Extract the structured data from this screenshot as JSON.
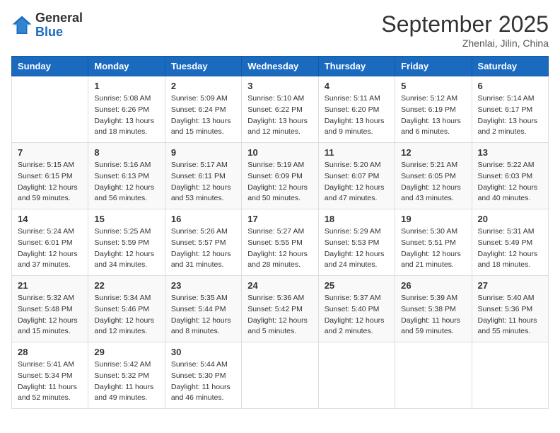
{
  "header": {
    "logo_general": "General",
    "logo_blue": "Blue",
    "title": "September 2025",
    "subtitle": "Zhenlai, Jilin, China"
  },
  "days_of_week": [
    "Sunday",
    "Monday",
    "Tuesday",
    "Wednesday",
    "Thursday",
    "Friday",
    "Saturday"
  ],
  "weeks": [
    [
      {
        "day": "",
        "info": ""
      },
      {
        "day": "1",
        "info": "Sunrise: 5:08 AM\nSunset: 6:26 PM\nDaylight: 13 hours\nand 18 minutes."
      },
      {
        "day": "2",
        "info": "Sunrise: 5:09 AM\nSunset: 6:24 PM\nDaylight: 13 hours\nand 15 minutes."
      },
      {
        "day": "3",
        "info": "Sunrise: 5:10 AM\nSunset: 6:22 PM\nDaylight: 13 hours\nand 12 minutes."
      },
      {
        "day": "4",
        "info": "Sunrise: 5:11 AM\nSunset: 6:20 PM\nDaylight: 13 hours\nand 9 minutes."
      },
      {
        "day": "5",
        "info": "Sunrise: 5:12 AM\nSunset: 6:19 PM\nDaylight: 13 hours\nand 6 minutes."
      },
      {
        "day": "6",
        "info": "Sunrise: 5:14 AM\nSunset: 6:17 PM\nDaylight: 13 hours\nand 2 minutes."
      }
    ],
    [
      {
        "day": "7",
        "info": "Sunrise: 5:15 AM\nSunset: 6:15 PM\nDaylight: 12 hours\nand 59 minutes."
      },
      {
        "day": "8",
        "info": "Sunrise: 5:16 AM\nSunset: 6:13 PM\nDaylight: 12 hours\nand 56 minutes."
      },
      {
        "day": "9",
        "info": "Sunrise: 5:17 AM\nSunset: 6:11 PM\nDaylight: 12 hours\nand 53 minutes."
      },
      {
        "day": "10",
        "info": "Sunrise: 5:19 AM\nSunset: 6:09 PM\nDaylight: 12 hours\nand 50 minutes."
      },
      {
        "day": "11",
        "info": "Sunrise: 5:20 AM\nSunset: 6:07 PM\nDaylight: 12 hours\nand 47 minutes."
      },
      {
        "day": "12",
        "info": "Sunrise: 5:21 AM\nSunset: 6:05 PM\nDaylight: 12 hours\nand 43 minutes."
      },
      {
        "day": "13",
        "info": "Sunrise: 5:22 AM\nSunset: 6:03 PM\nDaylight: 12 hours\nand 40 minutes."
      }
    ],
    [
      {
        "day": "14",
        "info": "Sunrise: 5:24 AM\nSunset: 6:01 PM\nDaylight: 12 hours\nand 37 minutes."
      },
      {
        "day": "15",
        "info": "Sunrise: 5:25 AM\nSunset: 5:59 PM\nDaylight: 12 hours\nand 34 minutes."
      },
      {
        "day": "16",
        "info": "Sunrise: 5:26 AM\nSunset: 5:57 PM\nDaylight: 12 hours\nand 31 minutes."
      },
      {
        "day": "17",
        "info": "Sunrise: 5:27 AM\nSunset: 5:55 PM\nDaylight: 12 hours\nand 28 minutes."
      },
      {
        "day": "18",
        "info": "Sunrise: 5:29 AM\nSunset: 5:53 PM\nDaylight: 12 hours\nand 24 minutes."
      },
      {
        "day": "19",
        "info": "Sunrise: 5:30 AM\nSunset: 5:51 PM\nDaylight: 12 hours\nand 21 minutes."
      },
      {
        "day": "20",
        "info": "Sunrise: 5:31 AM\nSunset: 5:49 PM\nDaylight: 12 hours\nand 18 minutes."
      }
    ],
    [
      {
        "day": "21",
        "info": "Sunrise: 5:32 AM\nSunset: 5:48 PM\nDaylight: 12 hours\nand 15 minutes."
      },
      {
        "day": "22",
        "info": "Sunrise: 5:34 AM\nSunset: 5:46 PM\nDaylight: 12 hours\nand 12 minutes."
      },
      {
        "day": "23",
        "info": "Sunrise: 5:35 AM\nSunset: 5:44 PM\nDaylight: 12 hours\nand 8 minutes."
      },
      {
        "day": "24",
        "info": "Sunrise: 5:36 AM\nSunset: 5:42 PM\nDaylight: 12 hours\nand 5 minutes."
      },
      {
        "day": "25",
        "info": "Sunrise: 5:37 AM\nSunset: 5:40 PM\nDaylight: 12 hours\nand 2 minutes."
      },
      {
        "day": "26",
        "info": "Sunrise: 5:39 AM\nSunset: 5:38 PM\nDaylight: 11 hours\nand 59 minutes."
      },
      {
        "day": "27",
        "info": "Sunrise: 5:40 AM\nSunset: 5:36 PM\nDaylight: 11 hours\nand 55 minutes."
      }
    ],
    [
      {
        "day": "28",
        "info": "Sunrise: 5:41 AM\nSunset: 5:34 PM\nDaylight: 11 hours\nand 52 minutes."
      },
      {
        "day": "29",
        "info": "Sunrise: 5:42 AM\nSunset: 5:32 PM\nDaylight: 11 hours\nand 49 minutes."
      },
      {
        "day": "30",
        "info": "Sunrise: 5:44 AM\nSunset: 5:30 PM\nDaylight: 11 hours\nand 46 minutes."
      },
      {
        "day": "",
        "info": ""
      },
      {
        "day": "",
        "info": ""
      },
      {
        "day": "",
        "info": ""
      },
      {
        "day": "",
        "info": ""
      }
    ]
  ]
}
